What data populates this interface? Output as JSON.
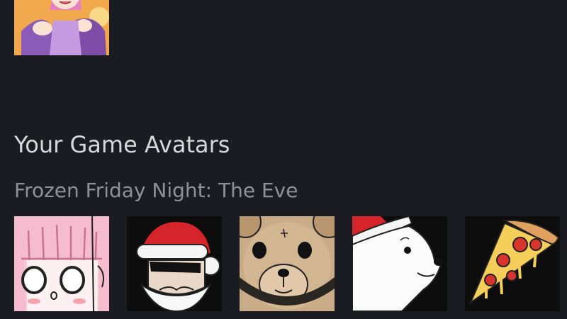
{
  "current_avatar": {
    "icon": "anime-girl-avatar-icon"
  },
  "section": {
    "title": "Your Game Avatars"
  },
  "game_group": {
    "title": "Frozen Friday Night: The Eve",
    "avatars": [
      {
        "icon": "pink-hair-girl-avatar-icon"
      },
      {
        "icon": "santa-sunglasses-avatar-icon"
      },
      {
        "icon": "teddy-bear-avatar-icon"
      },
      {
        "icon": "polar-bear-santa-hat-avatar-icon"
      },
      {
        "icon": "pizza-slice-avatar-icon"
      }
    ]
  }
}
